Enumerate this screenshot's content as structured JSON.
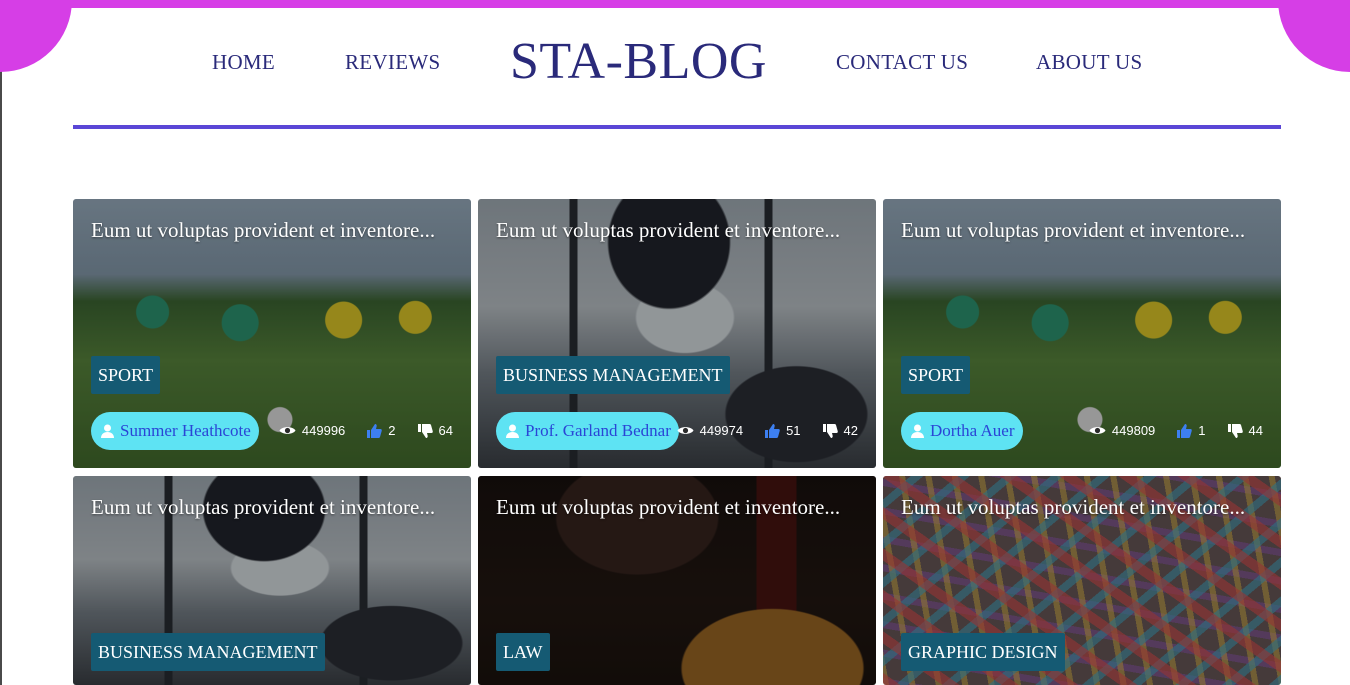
{
  "brand": "STA-BLOG",
  "nav": {
    "home": "HOME",
    "reviews": "REVIEWS",
    "contact": "CONTACT US",
    "about": "ABOUT US"
  },
  "colors": {
    "accent": "#d63ee6",
    "nav_text": "#2a2a7a",
    "rule": "#5a46d6",
    "category_bg": "#155a73",
    "author_pill": "#5ee3f3"
  },
  "posts": [
    {
      "title": "Eum ut voluptas provident et inventore...",
      "category": "SPORT",
      "author": "Summer Heathcote",
      "views": "449996",
      "likes": "2",
      "dislikes": "64",
      "image": "soccer-kids"
    },
    {
      "title": "Eum ut voluptas provident et inventore...",
      "category": "BUSINESS MANAGEMENT",
      "author": "Prof. Garland Bednar",
      "views": "449974",
      "likes": "51",
      "dislikes": "42",
      "image": "business-meeting"
    },
    {
      "title": "Eum ut voluptas provident et inventore...",
      "category": "SPORT",
      "author": "Dortha Auer",
      "views": "449809",
      "likes": "1",
      "dislikes": "44",
      "image": "soccer-kids"
    },
    {
      "title": "Eum ut voluptas provident et inventore...",
      "category": "BUSINESS MANAGEMENT",
      "image": "business-meeting"
    },
    {
      "title": "Eum ut voluptas provident et inventore...",
      "category": "LAW",
      "image": "gavel"
    },
    {
      "title": "Eum ut voluptas provident et inventore...",
      "category": "GRAPHIC DESIGN",
      "image": "doodle-art"
    }
  ]
}
